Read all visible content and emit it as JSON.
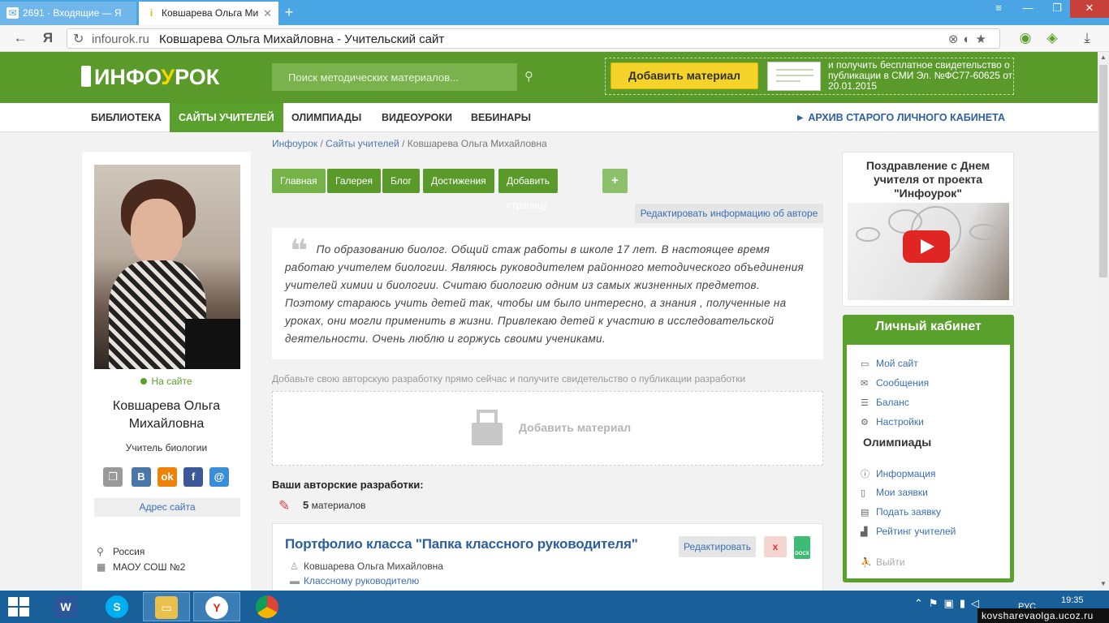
{
  "browser": {
    "tabs": [
      {
        "label": "2691 · Входящие — Я",
        "favicon": "mail-icon"
      },
      {
        "label": "Ковшарева Ольга Ми",
        "favicon": "infourok-icon"
      }
    ],
    "address": {
      "domain": "infourok.ru",
      "title": "Ковшарева Ольга Михайловна - Учительский сайт"
    },
    "yandex_letter": "Я"
  },
  "header": {
    "logo_white_1": "ИНФО",
    "logo_yellow": "У",
    "logo_white_2": "РОК",
    "search_placeholder": "Поиск методических материалов...",
    "add_material_label": "Добавить материал",
    "promo_text": "и получить бесплатное свидетельство о публикации в СМИ Эл. №ФС77-60625 от 20.01.2015"
  },
  "nav": {
    "items": [
      "БИБЛИОТЕКА",
      "САЙТЫ УЧИТЕЛЕЙ",
      "ОЛИМПИАДЫ",
      "ВИДЕОУРОКИ",
      "ВЕБИНАРЫ"
    ],
    "archive": "► АРХИВ СТАРОГО ЛИЧНОГО КАБИНЕТА"
  },
  "breadcrumb": {
    "home": "Инфоурок",
    "sep": " / ",
    "sites": "Сайты учителей",
    "current": "Ковшарева Ольга Михайловна"
  },
  "profile": {
    "status": "На сайте",
    "name": "Ковшарева Ольга Михайловна",
    "role": "Учитель биологии",
    "site_address_label": "Адрес сайта",
    "country": "Россия",
    "school": "МАОУ СОШ №2"
  },
  "page_tabs": [
    "Главная",
    "Галерея",
    "Блог",
    "Достижения",
    "Добавить страницу",
    "+"
  ],
  "edit_info_label": "Редактировать информацию об авторе",
  "about_text": "По образованию биолог. Общий стаж работы в школе 17 лет. В настоящее время работаю учителем биологии. Являюсь руководителем районного методического объединения учителей химии и биологии. Считаю биологию одним из самых жизненных предметов. Поэтому стараюсь учить детей так, чтобы им было интересно, а знания , полученные на уроках, они могли применить в жизни. Привлекаю детей к участию в исследовательской деятельности. Очень люблю и горжусь своими учениками.",
  "upload": {
    "hint": "Добавьте свою авторскую разработку прямо сейчас и получите свидетельство о публикации разработки",
    "label": "Добавить материал"
  },
  "works": {
    "heading": "Ваши авторские разработки:",
    "count": "5",
    "count_label": "материалов",
    "item": {
      "title": "Портфолио класса \"Папка классного руководителя\"",
      "edit": "Редактировать",
      "delete": "x",
      "filetype": "DOCX",
      "author": "Ковшарева Ольга Михайловна",
      "category": "Классному руководителю"
    }
  },
  "greeting": {
    "title": "Поздравление с Днем учителя от проекта \"Инфоурок\""
  },
  "cabinet": {
    "title": "Личный кабинет",
    "items": [
      "Мой сайт",
      "Сообщения",
      "Баланс",
      "Настройки"
    ],
    "olymp_heading": "Олимпиады",
    "olymp_items": [
      "Информация",
      "Мои заявки",
      "Подать заявку",
      "Рейтинг учителей"
    ],
    "logout": "Выйти"
  },
  "taskbar": {
    "lang": "РУС",
    "time": "19:35"
  },
  "watermark": "kovsharevaolga.ucoz.ru",
  "colors": {
    "brand_green": "#5a9a2a",
    "accent_yellow": "#f5d32a",
    "link_blue": "#3a6fb3",
    "taskbar": "#195f99"
  }
}
